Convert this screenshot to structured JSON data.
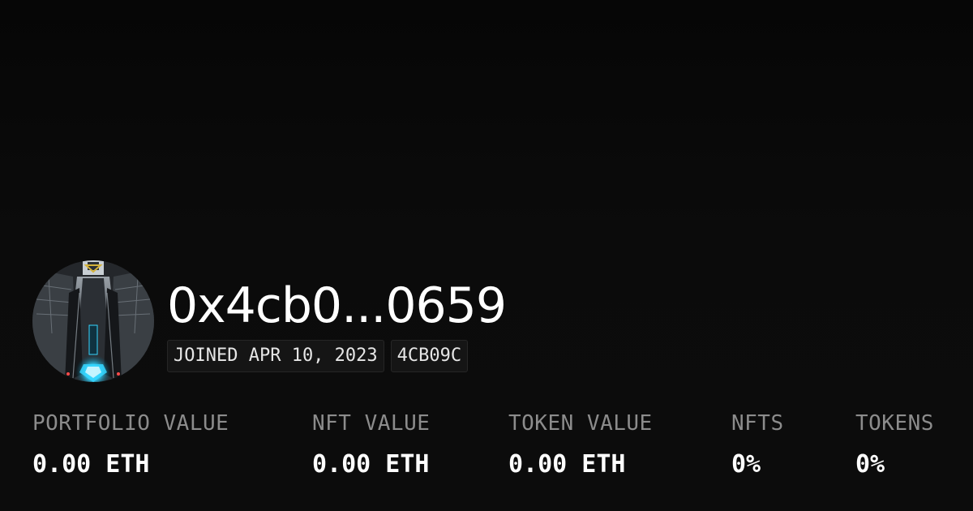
{
  "profile": {
    "address": "0x4cb0...0659",
    "joined": "JOINED APR 10, 2023",
    "short_id": "4CB09C",
    "avatar_icon": "avatar-image"
  },
  "stats": [
    {
      "label": "PORTFOLIO VALUE",
      "value": "0.00 ETH"
    },
    {
      "label": "NFT VALUE",
      "value": "0.00 ETH"
    },
    {
      "label": "TOKEN VALUE",
      "value": "0.00 ETH"
    },
    {
      "label": "NFTS",
      "value": "0%"
    },
    {
      "label": "TOKENS",
      "value": "0%"
    }
  ],
  "colors": {
    "background": "#0b0b0b",
    "text_primary": "#ffffff",
    "text_muted": "#8c8c8c",
    "tag_background": "#151515",
    "avatar_accent": "#35d6ff"
  }
}
